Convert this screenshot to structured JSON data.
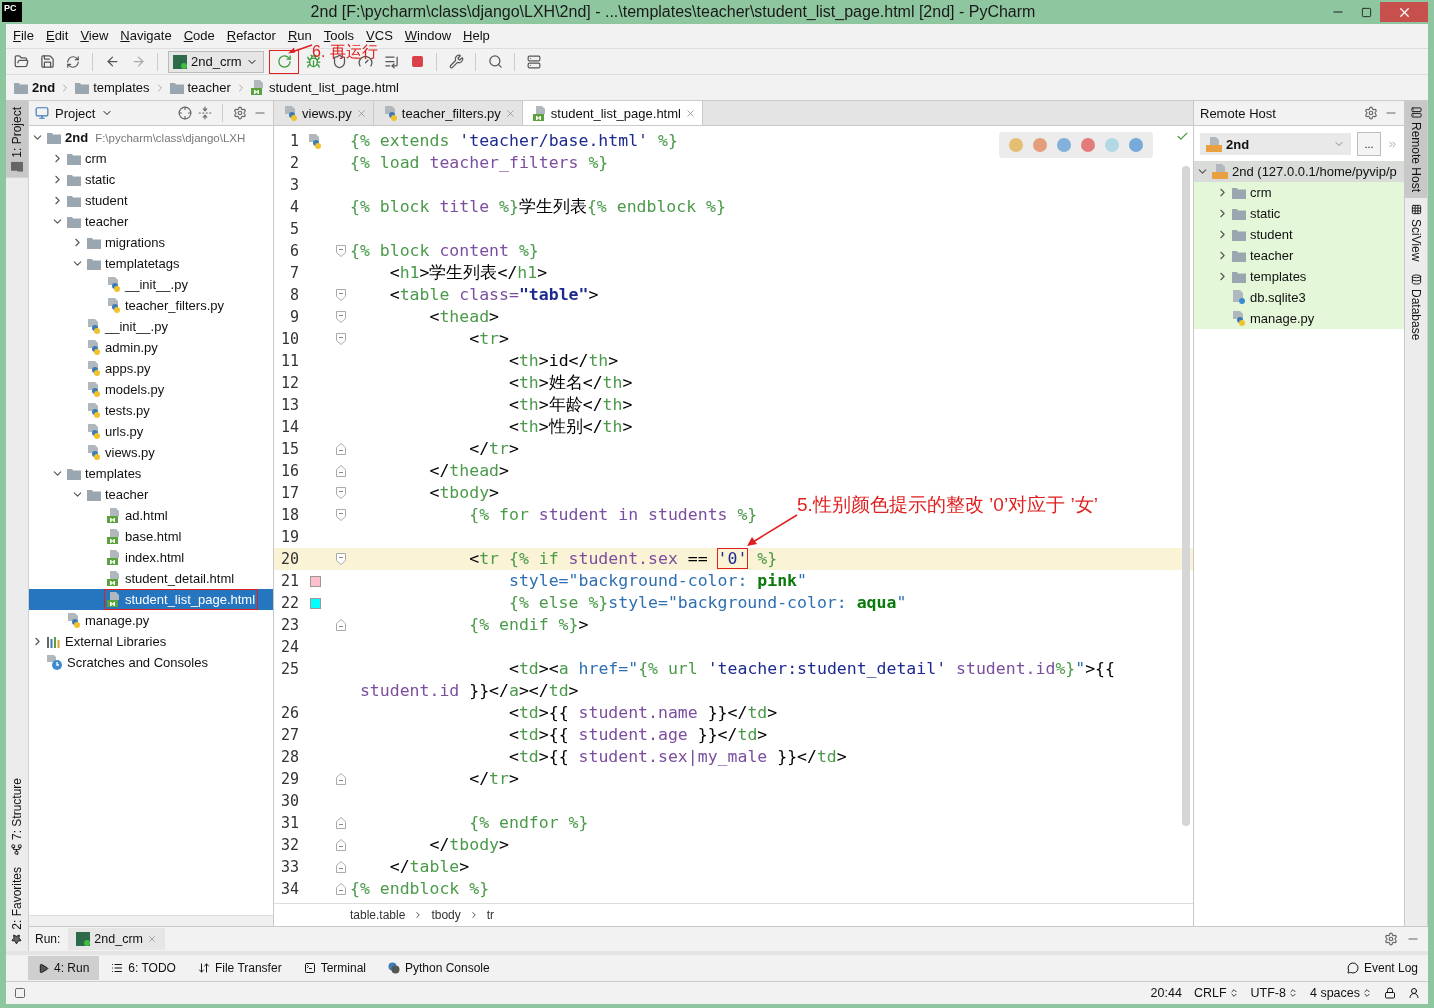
{
  "window": {
    "app_icon": "PC",
    "title": "2nd [F:\\pycharm\\class\\django\\LXH\\2nd] - ...\\templates\\teacher\\student_list_page.html [2nd] - PyCharm"
  },
  "menu": [
    "File",
    "Edit",
    "View",
    "Navigate",
    "Code",
    "Refactor",
    "Run",
    "Tools",
    "VCS",
    "Window",
    "Help"
  ],
  "toolbar": {
    "run_config": "2nd_crm"
  },
  "breadcrumb": [
    {
      "label": "2nd",
      "kind": "project"
    },
    {
      "label": "templates",
      "kind": "folder"
    },
    {
      "label": "teacher",
      "kind": "folder"
    },
    {
      "label": "student_list_page.html",
      "kind": "html"
    }
  ],
  "side_tabs": {
    "left": [
      {
        "label": "1: Project",
        "selected": true,
        "kind": "project"
      },
      {
        "label": "7: Structure",
        "selected": false,
        "kind": "structure"
      },
      {
        "label": "2: Favorites",
        "selected": false,
        "kind": "favorites"
      }
    ],
    "right": [
      {
        "label": "Remote Host",
        "selected": true
      },
      {
        "label": "SciView",
        "selected": false
      },
      {
        "label": "Database",
        "selected": false
      }
    ]
  },
  "project_panel": {
    "title": "Project",
    "tree": [
      {
        "label": "2nd",
        "path": "F:\\pycharm\\class\\django\\LXH",
        "kind": "root",
        "expanded": true,
        "selected": false,
        "children": [
          {
            "label": "crm",
            "kind": "folder",
            "expanded": false,
            "selected": false
          },
          {
            "label": "static",
            "kind": "folder",
            "expanded": false,
            "selected": false
          },
          {
            "label": "student",
            "kind": "folder",
            "expanded": false,
            "selected": false
          },
          {
            "label": "teacher",
            "kind": "folder",
            "expanded": true,
            "selected": false,
            "children": [
              {
                "label": "migrations",
                "kind": "folder",
                "expanded": false,
                "selected": false
              },
              {
                "label": "templatetags",
                "kind": "folder",
                "expanded": true,
                "selected": false,
                "children": [
                  {
                    "label": "__init__.py",
                    "kind": "py",
                    "selected": false
                  },
                  {
                    "label": "teacher_filters.py",
                    "kind": "py",
                    "selected": false
                  }
                ]
              },
              {
                "label": "__init__.py",
                "kind": "py",
                "selected": false
              },
              {
                "label": "admin.py",
                "kind": "py",
                "selected": false
              },
              {
                "label": "apps.py",
                "kind": "py",
                "selected": false
              },
              {
                "label": "models.py",
                "kind": "py",
                "selected": false
              },
              {
                "label": "tests.py",
                "kind": "py",
                "selected": false
              },
              {
                "label": "urls.py",
                "kind": "py",
                "selected": false
              },
              {
                "label": "views.py",
                "kind": "py",
                "selected": false
              }
            ]
          },
          {
            "label": "templates",
            "kind": "folder",
            "expanded": true,
            "selected": false,
            "children": [
              {
                "label": "teacher",
                "kind": "folder",
                "expanded": true,
                "selected": false,
                "children": [
                  {
                    "label": "ad.html",
                    "kind": "html",
                    "selected": false
                  },
                  {
                    "label": "base.html",
                    "kind": "html",
                    "selected": false
                  },
                  {
                    "label": "index.html",
                    "kind": "html",
                    "selected": false
                  },
                  {
                    "label": "student_detail.html",
                    "kind": "html",
                    "selected": false
                  },
                  {
                    "label": "student_list_page.html",
                    "kind": "html",
                    "selected": true,
                    "boxed": true
                  }
                ]
              }
            ]
          },
          {
            "label": "manage.py",
            "kind": "py",
            "selected": false
          }
        ]
      },
      {
        "label": "External Libraries",
        "kind": "lib",
        "expanded": false,
        "selected": false
      },
      {
        "label": "Scratches and Consoles",
        "kind": "scratch",
        "selected": false
      }
    ]
  },
  "editor": {
    "tabs": [
      {
        "label": "views.py",
        "kind": "py",
        "selected": false
      },
      {
        "label": "teacher_filters.py",
        "kind": "py",
        "selected": false
      },
      {
        "label": "student_list_page.html",
        "kind": "html",
        "selected": true
      }
    ],
    "lines": [
      {
        "number": "1",
        "file_icon": true,
        "tokens": [
          {
            "kind": "g",
            "text": "{% extends "
          },
          {
            "kind": "s",
            "text": "'teacher/base.html'"
          },
          {
            "kind": "g",
            "text": " %}"
          }
        ]
      },
      {
        "number": "2",
        "tokens": [
          {
            "kind": "g",
            "text": "{% load "
          },
          {
            "kind": "p",
            "text": "teacher_filters"
          },
          {
            "kind": "g",
            "text": " %}"
          }
        ]
      },
      {
        "number": "3"
      },
      {
        "number": "4",
        "tokens": [
          {
            "kind": "g",
            "text": "{% block "
          },
          {
            "kind": "p",
            "text": "title"
          },
          {
            "kind": "g",
            "text": " %}"
          },
          {
            "kind": "t",
            "text": "学生列表"
          },
          {
            "kind": "g",
            "text": "{% endblock %}"
          }
        ]
      },
      {
        "number": "5"
      },
      {
        "number": "6",
        "fold_open": true,
        "tokens": [
          {
            "kind": "g",
            "text": "{% block "
          },
          {
            "kind": "p",
            "text": "content"
          },
          {
            "kind": "g",
            "text": " %}"
          }
        ]
      },
      {
        "number": "7",
        "tokens": [
          {
            "kind": "t",
            "text": "    <"
          },
          {
            "kind": "g",
            "text": "h1"
          },
          {
            "kind": "t",
            "text": ">学生列表</"
          },
          {
            "kind": "g",
            "text": "h1"
          },
          {
            "kind": "t",
            "text": ">"
          }
        ]
      },
      {
        "number": "8",
        "fold_open": true,
        "tokens": [
          {
            "kind": "t",
            "text": "    <"
          },
          {
            "kind": "g",
            "text": "table "
          },
          {
            "kind": "p",
            "text": "class="
          },
          {
            "kind": "sb",
            "text": "\"table\""
          },
          {
            "kind": "t",
            "text": ">"
          }
        ]
      },
      {
        "number": "9",
        "fold_open": true,
        "tokens": [
          {
            "kind": "t",
            "text": "        <"
          },
          {
            "kind": "g",
            "text": "thead"
          },
          {
            "kind": "t",
            "text": ">"
          }
        ]
      },
      {
        "number": "10",
        "fold_open": true,
        "tokens": [
          {
            "kind": "t",
            "text": "            <"
          },
          {
            "kind": "g",
            "text": "tr"
          },
          {
            "kind": "t",
            "text": ">"
          }
        ]
      },
      {
        "number": "11",
        "tokens": [
          {
            "kind": "t",
            "text": "                <"
          },
          {
            "kind": "g",
            "text": "th"
          },
          {
            "kind": "t",
            "text": ">id</"
          },
          {
            "kind": "g",
            "text": "th"
          },
          {
            "kind": "t",
            "text": ">"
          }
        ]
      },
      {
        "number": "12",
        "tokens": [
          {
            "kind": "t",
            "text": "                <"
          },
          {
            "kind": "g",
            "text": "th"
          },
          {
            "kind": "t",
            "text": ">姓名</"
          },
          {
            "kind": "g",
            "text": "th"
          },
          {
            "kind": "t",
            "text": ">"
          }
        ]
      },
      {
        "number": "13",
        "tokens": [
          {
            "kind": "t",
            "text": "                <"
          },
          {
            "kind": "g",
            "text": "th"
          },
          {
            "kind": "t",
            "text": ">年龄</"
          },
          {
            "kind": "g",
            "text": "th"
          },
          {
            "kind": "t",
            "text": ">"
          }
        ]
      },
      {
        "number": "14",
        "tokens": [
          {
            "kind": "t",
            "text": "                <"
          },
          {
            "kind": "g",
            "text": "th"
          },
          {
            "kind": "t",
            "text": ">性别</"
          },
          {
            "kind": "g",
            "text": "th"
          },
          {
            "kind": "t",
            "text": ">"
          }
        ]
      },
      {
        "number": "15",
        "fold_close": true,
        "tokens": [
          {
            "kind": "t",
            "text": "            </"
          },
          {
            "kind": "g",
            "text": "tr"
          },
          {
            "kind": "t",
            "text": ">"
          }
        ]
      },
      {
        "number": "16",
        "fold_close": true,
        "tokens": [
          {
            "kind": "t",
            "text": "        </"
          },
          {
            "kind": "g",
            "text": "thead"
          },
          {
            "kind": "t",
            "text": ">"
          }
        ]
      },
      {
        "number": "17",
        "fold_open": true,
        "tokens": [
          {
            "kind": "t",
            "text": "        <"
          },
          {
            "kind": "g",
            "text": "tbody"
          },
          {
            "kind": "t",
            "text": ">"
          }
        ]
      },
      {
        "number": "18",
        "fold_open": true,
        "tokens": [
          {
            "kind": "g",
            "text": "            {% for "
          },
          {
            "kind": "p",
            "text": "student in students"
          },
          {
            "kind": "g",
            "text": " %}"
          }
        ]
      },
      {
        "number": "19"
      },
      {
        "number": "20",
        "fold_open": true,
        "current": true,
        "tokens": [
          {
            "kind": "t",
            "text": "            <"
          },
          {
            "kind": "g",
            "text": "tr "
          },
          {
            "kind": "g",
            "text": "{% if "
          },
          {
            "kind": "p",
            "text": "student.sex"
          },
          {
            "kind": "t",
            "text": " == "
          },
          {
            "kind": "s",
            "text": "'0'",
            "boxed": true
          },
          {
            "kind": "g",
            "text": " %}"
          }
        ]
      },
      {
        "number": "21",
        "color": "#ffc0cb",
        "tokens": [
          {
            "kind": "a",
            "text": "                style=\"background-color: "
          },
          {
            "kind": "vb",
            "text": "pink"
          },
          {
            "kind": "a",
            "text": "\""
          }
        ]
      },
      {
        "number": "22",
        "color": "#00ffff",
        "tokens": [
          {
            "kind": "g",
            "text": "                {% else %}"
          },
          {
            "kind": "a",
            "text": "style=\"background-color: "
          },
          {
            "kind": "vb",
            "text": "aqua"
          },
          {
            "kind": "a",
            "text": "\""
          }
        ]
      },
      {
        "number": "23",
        "fold_close": true,
        "tokens": [
          {
            "kind": "g",
            "text": "            {% endif %}"
          },
          {
            "kind": "t",
            "text": ">"
          }
        ]
      },
      {
        "number": "24"
      },
      {
        "number": "25",
        "tokens": [
          {
            "kind": "t",
            "text": "                <"
          },
          {
            "kind": "g",
            "text": "td"
          },
          {
            "kind": "t",
            "text": "><"
          },
          {
            "kind": "g",
            "text": "a "
          },
          {
            "kind": "a",
            "text": "href=\""
          },
          {
            "kind": "g",
            "text": "{% url "
          },
          {
            "kind": "s",
            "text": "'teacher:student_detail' "
          },
          {
            "kind": "p",
            "text": "student.id"
          },
          {
            "kind": "g",
            "text": "%}"
          },
          {
            "kind": "a",
            "text": "\""
          },
          {
            "kind": "t",
            "text": ">{{"
          }
        ]
      },
      {
        "tokens": [
          {
            "kind": "p",
            "text": " student.id"
          },
          {
            "kind": "t",
            "text": " }}</"
          },
          {
            "kind": "g",
            "text": "a"
          },
          {
            "kind": "t",
            "text": "></"
          },
          {
            "kind": "g",
            "text": "td"
          },
          {
            "kind": "t",
            "text": ">"
          }
        ]
      },
      {
        "number": "26",
        "tokens": [
          {
            "kind": "t",
            "text": "                <"
          },
          {
            "kind": "g",
            "text": "td"
          },
          {
            "kind": "t",
            "text": ">{{ "
          },
          {
            "kind": "p",
            "text": "student.name"
          },
          {
            "kind": "t",
            "text": " }}</"
          },
          {
            "kind": "g",
            "text": "td"
          },
          {
            "kind": "t",
            "text": ">"
          }
        ]
      },
      {
        "number": "27",
        "tokens": [
          {
            "kind": "t",
            "text": "                <"
          },
          {
            "kind": "g",
            "text": "td"
          },
          {
            "kind": "t",
            "text": ">{{ "
          },
          {
            "kind": "p",
            "text": "student.age"
          },
          {
            "kind": "t",
            "text": " }}</"
          },
          {
            "kind": "g",
            "text": "td"
          },
          {
            "kind": "t",
            "text": ">"
          }
        ]
      },
      {
        "number": "28",
        "tokens": [
          {
            "kind": "t",
            "text": "                <"
          },
          {
            "kind": "g",
            "text": "td"
          },
          {
            "kind": "t",
            "text": ">{{ "
          },
          {
            "kind": "p",
            "text": "student.sex|my_male"
          },
          {
            "kind": "t",
            "text": " }}</"
          },
          {
            "kind": "g",
            "text": "td"
          },
          {
            "kind": "t",
            "text": ">"
          }
        ]
      },
      {
        "number": "29",
        "fold_close": true,
        "tokens": [
          {
            "kind": "t",
            "text": "            </"
          },
          {
            "kind": "g",
            "text": "tr"
          },
          {
            "kind": "t",
            "text": ">"
          }
        ]
      },
      {
        "number": "30"
      },
      {
        "number": "31",
        "fold_close": true,
        "tokens": [
          {
            "kind": "g",
            "text": "            {% endfor %}"
          }
        ]
      },
      {
        "number": "32",
        "fold_close": true,
        "tokens": [
          {
            "kind": "t",
            "text": "        </"
          },
          {
            "kind": "g",
            "text": "tbody"
          },
          {
            "kind": "t",
            "text": ">"
          }
        ]
      },
      {
        "number": "33",
        "fold_close": true,
        "tokens": [
          {
            "kind": "t",
            "text": "    </"
          },
          {
            "kind": "g",
            "text": "table"
          },
          {
            "kind": "t",
            "text": ">"
          }
        ]
      },
      {
        "number": "34",
        "fold_close": true,
        "tokens": [
          {
            "kind": "g",
            "text": "{% endblock %}"
          }
        ]
      }
    ],
    "path": [
      "table.table",
      "tbody",
      "tr"
    ]
  },
  "remote_host": {
    "title": "Remote Host",
    "server": "2nd",
    "more": "...",
    "tree": [
      {
        "label": "2nd (127.0.0.1/home/pyvip/p",
        "kind": "server",
        "expanded": true,
        "selected": true,
        "children": [
          {
            "label": "crm",
            "kind": "folder",
            "expanded": false,
            "selected": false
          },
          {
            "label": "static",
            "kind": "folder",
            "expanded": false,
            "selected": false
          },
          {
            "label": "student",
            "kind": "folder",
            "expanded": false,
            "selected": false
          },
          {
            "label": "teacher",
            "kind": "folder",
            "expanded": false,
            "selected": false
          },
          {
            "label": "templates",
            "kind": "folder",
            "expanded": false,
            "selected": false
          },
          {
            "label": "db.sqlite3",
            "kind": "db",
            "selected": false
          },
          {
            "label": "manage.py",
            "kind": "py",
            "selected": false
          }
        ]
      }
    ]
  },
  "run_bar": {
    "label": "Run:",
    "tab": "2nd_crm"
  },
  "tool_windows": [
    {
      "label": "4: Run",
      "kind": "run",
      "selected": true
    },
    {
      "label": "6: TODO",
      "kind": "todo",
      "selected": false
    },
    {
      "label": "File Transfer",
      "kind": "transfer",
      "selected": false
    },
    {
      "label": "Terminal",
      "kind": "terminal",
      "selected": false
    },
    {
      "label": "Python Console",
      "kind": "console",
      "selected": false
    }
  ],
  "event_log": "Event Log",
  "status": [
    {
      "text": "20:44"
    },
    {
      "text": "CRLF",
      "dropdown": true
    },
    {
      "text": "UTF-8",
      "dropdown": true
    },
    {
      "text": "4 spaces",
      "dropdown": true
    }
  ],
  "annotations": [
    {
      "text": "6. 再运行"
    },
    {
      "text": "5.性别颜色提示的整改 ’0’对应于 ’女’"
    }
  ]
}
